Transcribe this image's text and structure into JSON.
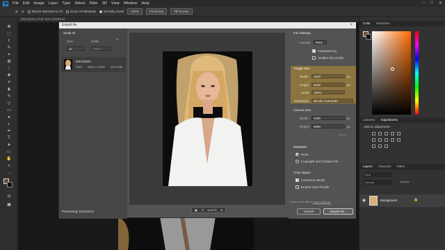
{
  "menu": {
    "logo": "Ps",
    "items": [
      "File",
      "Edit",
      "Image",
      "Layer",
      "Type",
      "Select",
      "Filter",
      "3D",
      "View",
      "Window",
      "Help"
    ]
  },
  "options": {
    "resize": "Resize Windows to Fit",
    "zoom_all": "Zoom All Windows",
    "scrubby": "Scrubby Zoom",
    "pct": "100%",
    "fit": "Fit Screen",
    "fill": "Fill Screen"
  },
  "doc_tab": "DSC02341.tif @ 25% (RGB/16)",
  "panels": {
    "color": "Color",
    "swatches": "Swatches",
    "libraries": "Libraries",
    "adjustments": "Adjustments",
    "add_adjustment": "Add an adjustment",
    "layers": "Layers",
    "channels": "Channels",
    "paths": "Paths",
    "kind": "Kind",
    "normal": "Normal",
    "opacity": "Opacity",
    "layer_name": "Background"
  },
  "dialog": {
    "title": "Export As",
    "left": {
      "scale_all": "Scale All",
      "size_h": "Size",
      "suffix_h": "Suffix",
      "size_val": "1x",
      "suffix_ph": "none",
      "file_name": "DSC02341",
      "file_fmt": "PNG",
      "file_dims": "4000 x 6000",
      "file_size": "26.8 MB",
      "previewing": "Previewing: DSC02341"
    },
    "zoom": "16.67%",
    "settings": {
      "file_settings": "File Settings",
      "format_lbl": "Format:",
      "format_val": "PNG",
      "transparency": "Transparency",
      "smaller": "Smaller File (8-bit)",
      "image_size": "Image Size",
      "width_lbl": "Width:",
      "width_val": "4000",
      "height_lbl": "Height:",
      "height_val": "6000",
      "scale_lbl": "Scale:",
      "scale_val": "100%",
      "px": "px",
      "resample_lbl": "Resample:",
      "resample_val": "Bicubic Automatic",
      "canvas_size": "Canvas Size",
      "cwidth_val": "4000",
      "cheight_val": "6000",
      "reset": "Reset",
      "metadata": "Metadata",
      "none": "None",
      "copyright": "Copyright and Contact Info",
      "color_space": "Color Space",
      "convert": "Convert to sRGB",
      "embed": "Embed Color Profile",
      "learn": "Learn more about",
      "export_options": "export options.",
      "cancel": "Cancel",
      "export_all": "Export All..."
    }
  },
  "colors": {
    "accent": "#31a8ff",
    "highlight": "#8b7440"
  }
}
